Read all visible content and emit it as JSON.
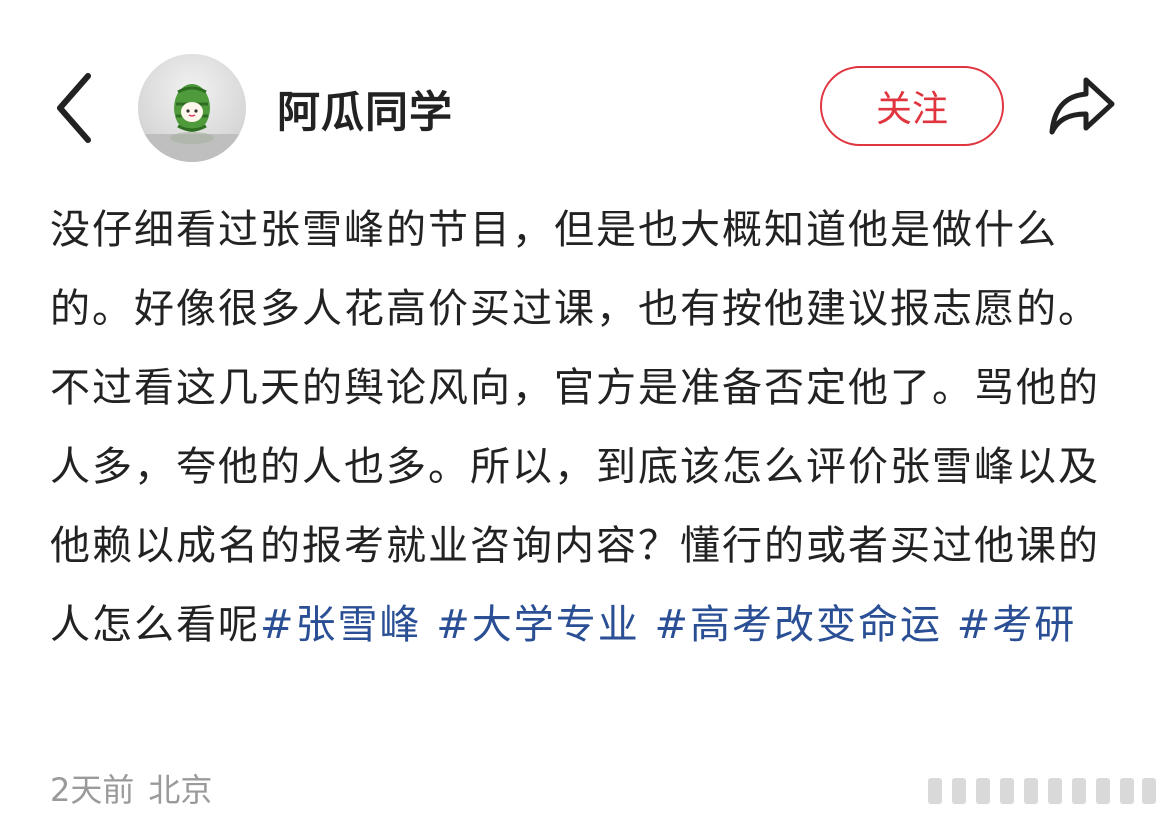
{
  "header": {
    "back_icon": "chevron-left-icon",
    "username": "阿瓜同学",
    "follow_label": "关注",
    "share_icon": "share-arrow-icon"
  },
  "post": {
    "text": "没仔细看过张雪峰的节目，但是也大概知道他是做什么的。好像很多人花高价买过课，也有按他建议报志愿的。不过看这几天的舆论风向，官方是准备否定他了。骂他的人多，夸他的人也多。所以，到底该怎么评价张雪峰以及他赖以成名的报考就业咨询内容？懂行的或者买过他课的人怎么看呢",
    "hashtags": [
      "#张雪峰",
      "#大学专业",
      "#高考改变命运",
      "#考研"
    ]
  },
  "meta": {
    "time": "2天前",
    "location": "北京"
  },
  "colors": {
    "accent_red": "#e0343f",
    "hashtag_blue": "#2a4f94",
    "text": "#222222",
    "muted": "#9a9a9a"
  }
}
